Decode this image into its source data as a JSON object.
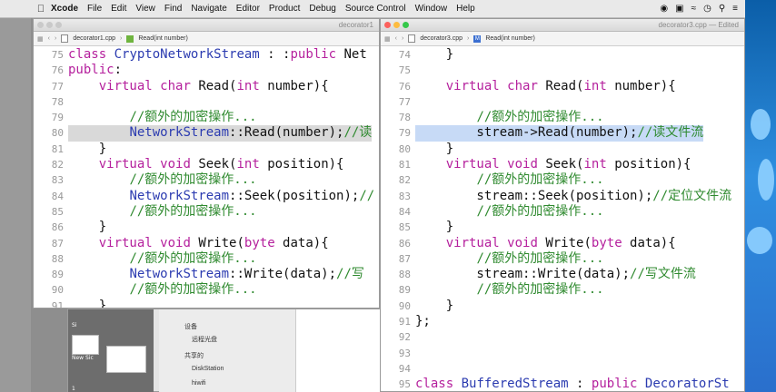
{
  "menubar": {
    "app": "Xcode",
    "items": [
      "File",
      "Edit",
      "View",
      "Find",
      "Navigate",
      "Editor",
      "Product",
      "Debug",
      "Source Control",
      "Window",
      "Help"
    ]
  },
  "finder": {
    "thumbs": [
      "Si",
      "New Sic",
      "1"
    ],
    "sidebar": [
      "设备",
      "远程光盘",
      "共享的",
      "DiskStation",
      "hiwifi"
    ]
  },
  "window1": {
    "title": "decorator1",
    "jumpbar": [
      "decorator1.cpp",
      "Read(int number)"
    ],
    "lines": [
      {
        "n": "75",
        "t": "class CryptoNetworkStream : :public Net"
      },
      {
        "n": "76",
        "t": "public:"
      },
      {
        "n": "77",
        "t": "    virtual char Read(int number){"
      },
      {
        "n": "78",
        "t": ""
      },
      {
        "n": "79",
        "t": "        //额外的加密操作..."
      },
      {
        "n": "80",
        "t": "        NetworkStream::Read(number);//读"
      },
      {
        "n": "81",
        "t": "    }"
      },
      {
        "n": "82",
        "t": "    virtual void Seek(int position){"
      },
      {
        "n": "83",
        "t": "        //额外的加密操作..."
      },
      {
        "n": "84",
        "t": "        NetworkStream::Seek(position);//"
      },
      {
        "n": "85",
        "t": "        //额外的加密操作..."
      },
      {
        "n": "86",
        "t": "    }"
      },
      {
        "n": "87",
        "t": "    virtual void Write(byte data){"
      },
      {
        "n": "88",
        "t": "        //额外的加密操作..."
      },
      {
        "n": "89",
        "t": "        NetworkStream::Write(data);//写"
      },
      {
        "n": "90",
        "t": "        //额外的加密操作..."
      },
      {
        "n": "91",
        "t": "    }"
      }
    ]
  },
  "window2": {
    "title": "decorator3.cpp — Edited",
    "jumpbar": [
      "decorator3.cpp",
      "Read(int number)"
    ],
    "lines": [
      {
        "n": "74",
        "t": "    }"
      },
      {
        "n": "75",
        "t": ""
      },
      {
        "n": "76",
        "t": "    virtual char Read(int number){"
      },
      {
        "n": "77",
        "t": ""
      },
      {
        "n": "78",
        "t": "        //额外的加密操作..."
      },
      {
        "n": "79",
        "t": "        stream->Read(number);//读文件流"
      },
      {
        "n": "80",
        "t": "    }"
      },
      {
        "n": "81",
        "t": "    virtual void Seek(int position){"
      },
      {
        "n": "82",
        "t": "        //额外的加密操作..."
      },
      {
        "n": "83",
        "t": "        stream::Seek(position);//定位文件流"
      },
      {
        "n": "84",
        "t": "        //额外的加密操作..."
      },
      {
        "n": "85",
        "t": "    }"
      },
      {
        "n": "86",
        "t": "    virtual void Write(byte data){"
      },
      {
        "n": "87",
        "t": "        //额外的加密操作..."
      },
      {
        "n": "88",
        "t": "        stream::Write(data);//写文件流"
      },
      {
        "n": "89",
        "t": "        //额外的加密操作..."
      },
      {
        "n": "90",
        "t": "    }"
      },
      {
        "n": "91",
        "t": "};"
      },
      {
        "n": "92",
        "t": ""
      },
      {
        "n": "93",
        "t": ""
      },
      {
        "n": "94",
        "t": ""
      },
      {
        "n": "95",
        "t": "class BufferedStream : public DecoratorSt"
      }
    ]
  },
  "colors": {
    "keyword": "#b5209d",
    "comment": "#2f8a2f",
    "class": "#2b3bb0",
    "selection": "#c7daf6"
  }
}
